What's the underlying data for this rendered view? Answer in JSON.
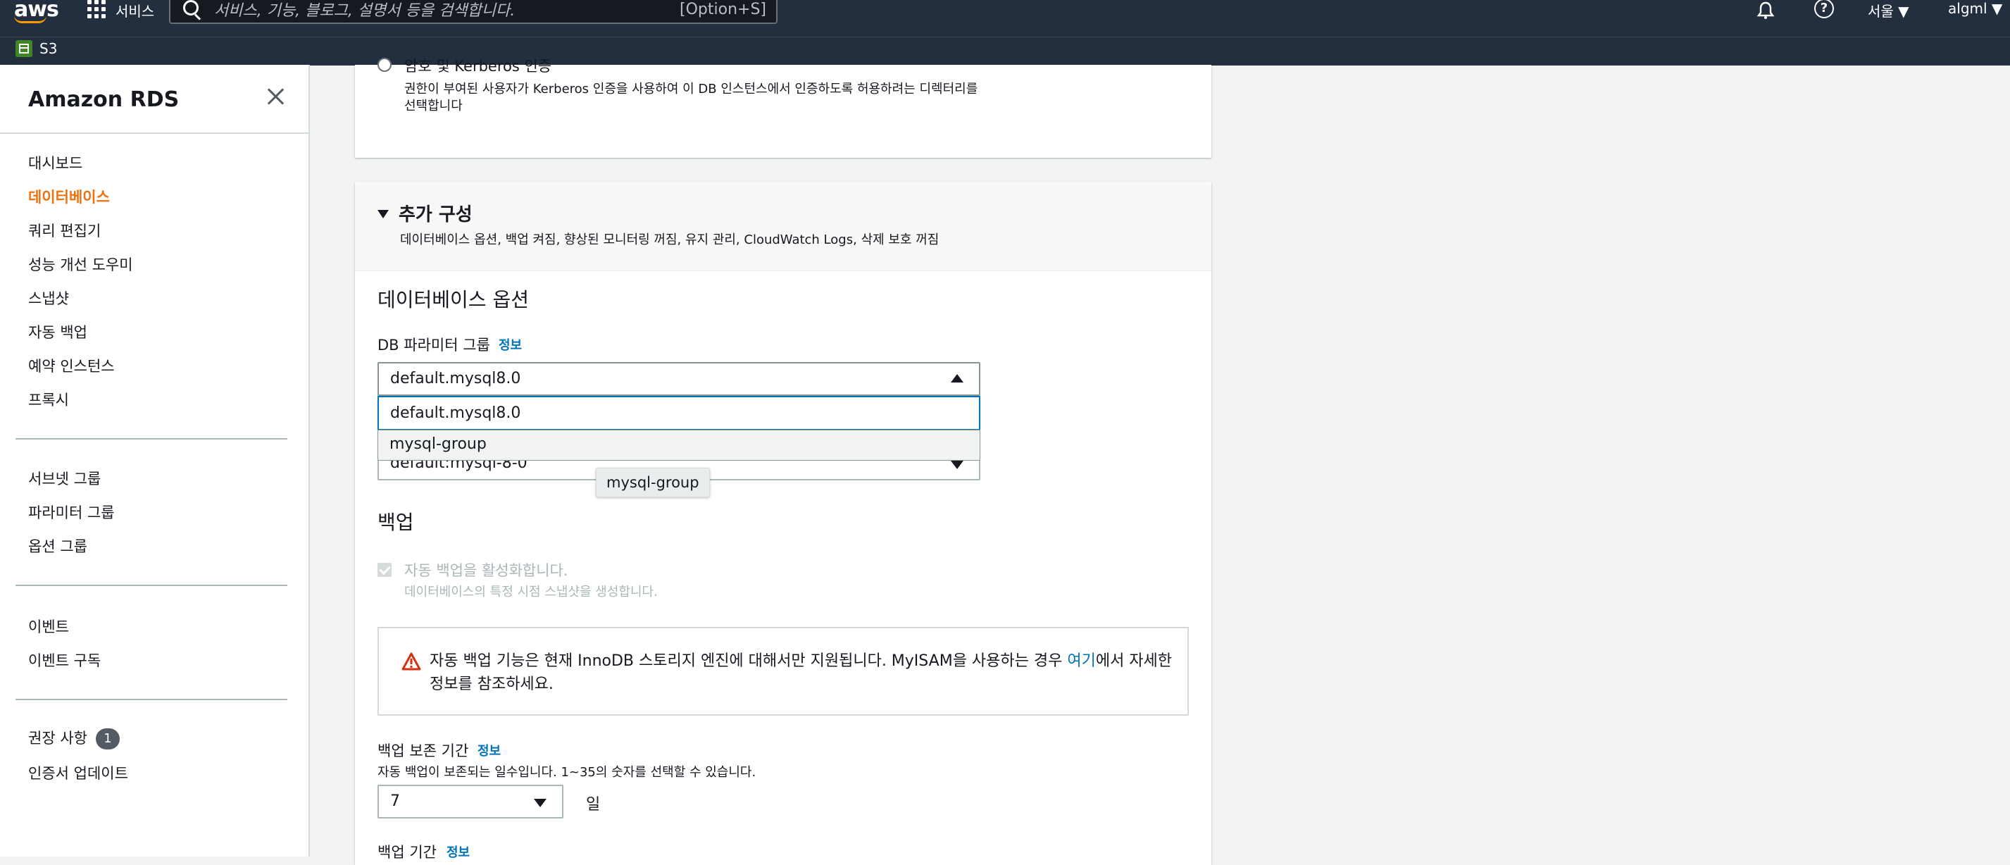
{
  "topbar": {
    "logo_text": "aws",
    "services_label": "서비스",
    "search_placeholder": "서비스, 기능, 블로그, 설명서 등을 검색합니다.",
    "search_shortcut": "[Option+S]",
    "region": "서울 ▼",
    "user": "algml ▼"
  },
  "bookmarks": {
    "s3_label": "S3"
  },
  "sidebar": {
    "title": "Amazon RDS",
    "group1": [
      {
        "label": "대시보드"
      },
      {
        "label": "데이터베이스",
        "active": true
      },
      {
        "label": "쿼리 편집기"
      },
      {
        "label": "성능 개선 도우미"
      },
      {
        "label": "스냅샷"
      },
      {
        "label": "자동 백업"
      },
      {
        "label": "예약 인스턴스"
      },
      {
        "label": "프록시"
      }
    ],
    "group2": [
      {
        "label": "서브넷 그룹"
      },
      {
        "label": "파라미터 그룹"
      },
      {
        "label": "옵션 그룹"
      }
    ],
    "group3": [
      {
        "label": "이벤트"
      },
      {
        "label": "이벤트 구독"
      }
    ],
    "group4": [
      {
        "label": "권장 사항",
        "badge": "1"
      },
      {
        "label": "인증서 업데이트"
      }
    ]
  },
  "auth_panel": {
    "radio_label": "암호 및 Kerberos 인증",
    "desc_line1": "권한이 부여된 사용자가 Kerberos 인증을 사용하여 이 DB 인스턴스에서 인증하도록 허용하려는 디렉터리를",
    "desc_line2": "선택합니다"
  },
  "additional_config": {
    "title": "추가 구성",
    "summary": "데이터베이스 옵션, 백업 켜짐, 향상된 모니터링 꺼짐, 유지 관리, CloudWatch Logs, 삭제 보호 꺼짐",
    "db_options_title": "데이터베이스 옵션",
    "param_group_label": "DB 파라미터 그룹",
    "info_label": "정보",
    "param_group_value": "default.mysql8.0",
    "param_group_options": [
      "default.mysql8.0",
      "mysql-group"
    ],
    "hover_tooltip": "mysql-group",
    "option_group_value": "default:mysql-8-0",
    "backup_title": "백업",
    "auto_backup_label": "자동 백업을 활성화합니다.",
    "auto_backup_desc": "데이터베이스의 특정 시점 스냅샷을 생성합니다.",
    "alert_prefix": "자동 백업 기능은 현재 InnoDB 스토리지 엔진에 대해서만 지원됩니다. MyISAM을 사용하는 경우 ",
    "alert_link": "여기",
    "alert_suffix": "에서 자세한 정보를 참조하세요.",
    "retention_label": "백업 보존 기간",
    "retention_desc": "자동 백업이 보존되는 일수입니다. 1~35의 숫자를 선택할 수 있습니다.",
    "retention_value": "7",
    "retention_unit": "일",
    "backup_window_label": "백업 기간"
  },
  "colors": {
    "header_bg": "#232f3e",
    "active_nav": "#ec7211",
    "link": "#0073bb",
    "warning": "#d13212"
  }
}
